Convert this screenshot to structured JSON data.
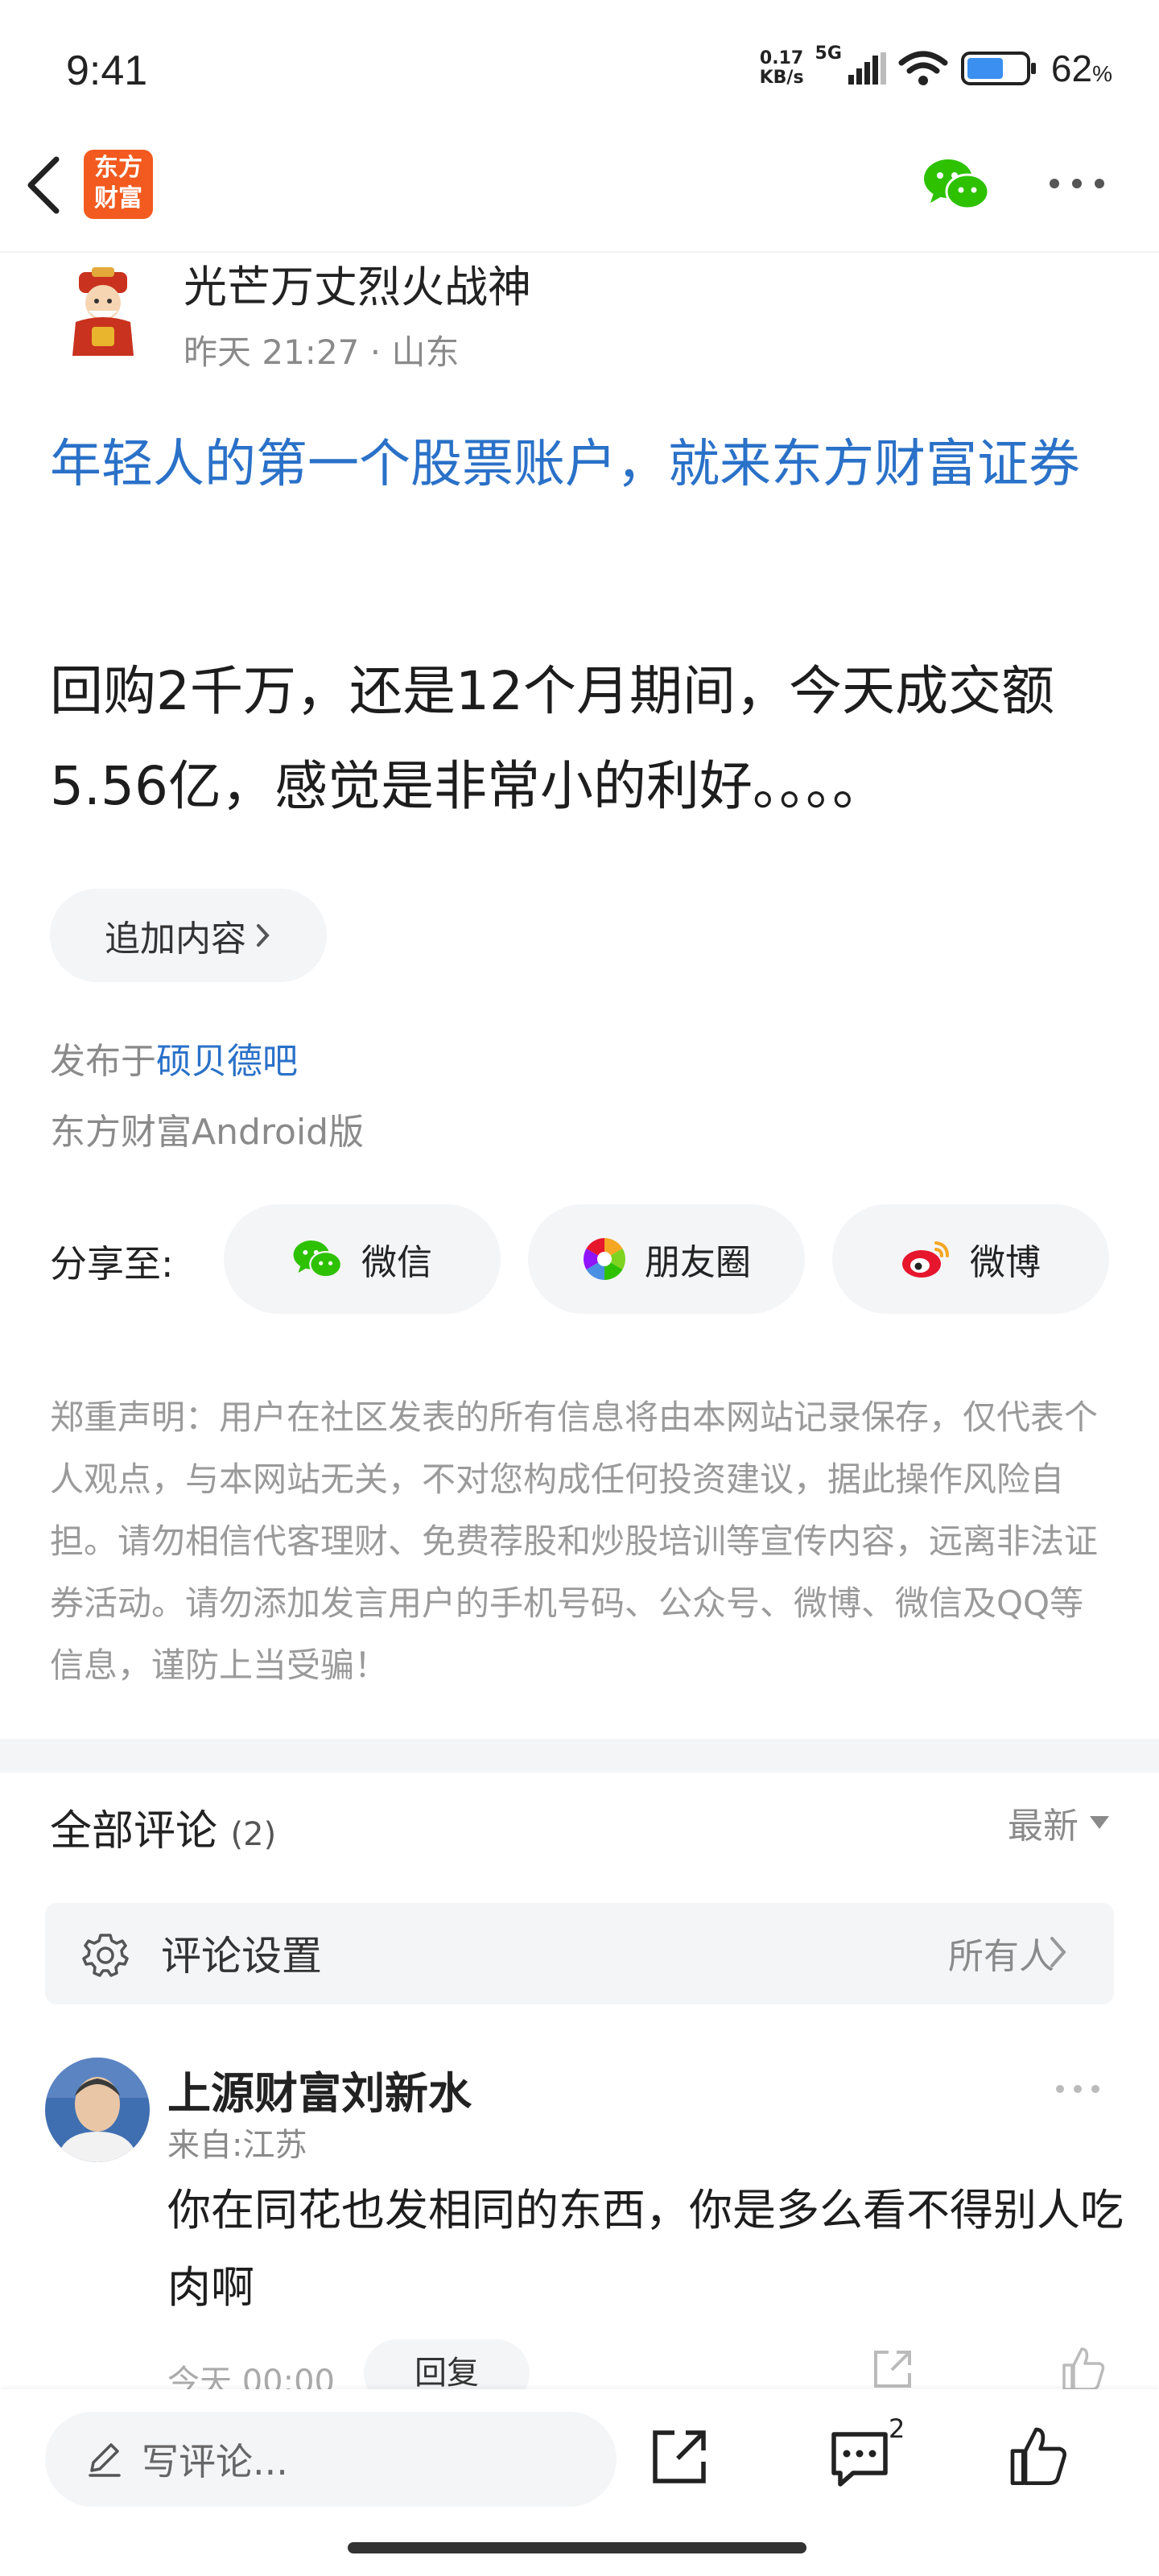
{
  "status_bar": {
    "time": "9:41",
    "net_speed_value": "0.17",
    "net_speed_unit": "KB/s",
    "network": "5G",
    "battery_percent": "62",
    "battery_unit": "%"
  },
  "header": {
    "logo_line1": "东方",
    "logo_line2": "财富"
  },
  "post": {
    "author": "光芒万丈烈火战神",
    "time": "昨天 21:27",
    "location": "山东",
    "title": "年轻人的第一个股票账户，就来东方财富证券",
    "content": "回购2千万，还是12个月期间，今天成交额5.56亿，感觉是非常小的利好。。。。",
    "append_label": "追加内容",
    "published_prefix": "发布于",
    "published_board": "硕贝德吧",
    "client": "东方财富Android版"
  },
  "share": {
    "label": "分享至:",
    "options": [
      {
        "label": "微信",
        "icon": "wechat-icon"
      },
      {
        "label": "朋友圈",
        "icon": "moments-icon"
      },
      {
        "label": "微博",
        "icon": "weibo-icon"
      }
    ]
  },
  "disclaimer": "郑重声明：用户在社区发表的所有信息将由本网站记录保存，仅代表个人观点，与本网站无关，不对您构成任何投资建议，据此操作风险自担。请勿相信代客理财、免费荐股和炒股培训等宣传内容，远离非法证券活动。请勿添加发言用户的手机号码、公众号、微博、微信及QQ等信息，谨防上当受骗！",
  "comments": {
    "title": "全部评论",
    "count": "(2)",
    "sort": "最新",
    "settings_label": "评论设置",
    "settings_value": "所有人",
    "items": [
      {
        "name": "上源财富刘新水",
        "location": "来自:江苏",
        "text": "你在同花也发相同的东西，你是多么看不得别人吃肉啊",
        "time": "今天 00:00",
        "reply_label": "回复"
      }
    ]
  },
  "bottom_bar": {
    "write_placeholder": "写评论...",
    "comment_count": "2"
  },
  "colors": {
    "brand_orange": "#f25a1f",
    "link_blue": "#2a71c8",
    "wechat_green": "#2dc100",
    "weibo_red": "#e6162d"
  }
}
